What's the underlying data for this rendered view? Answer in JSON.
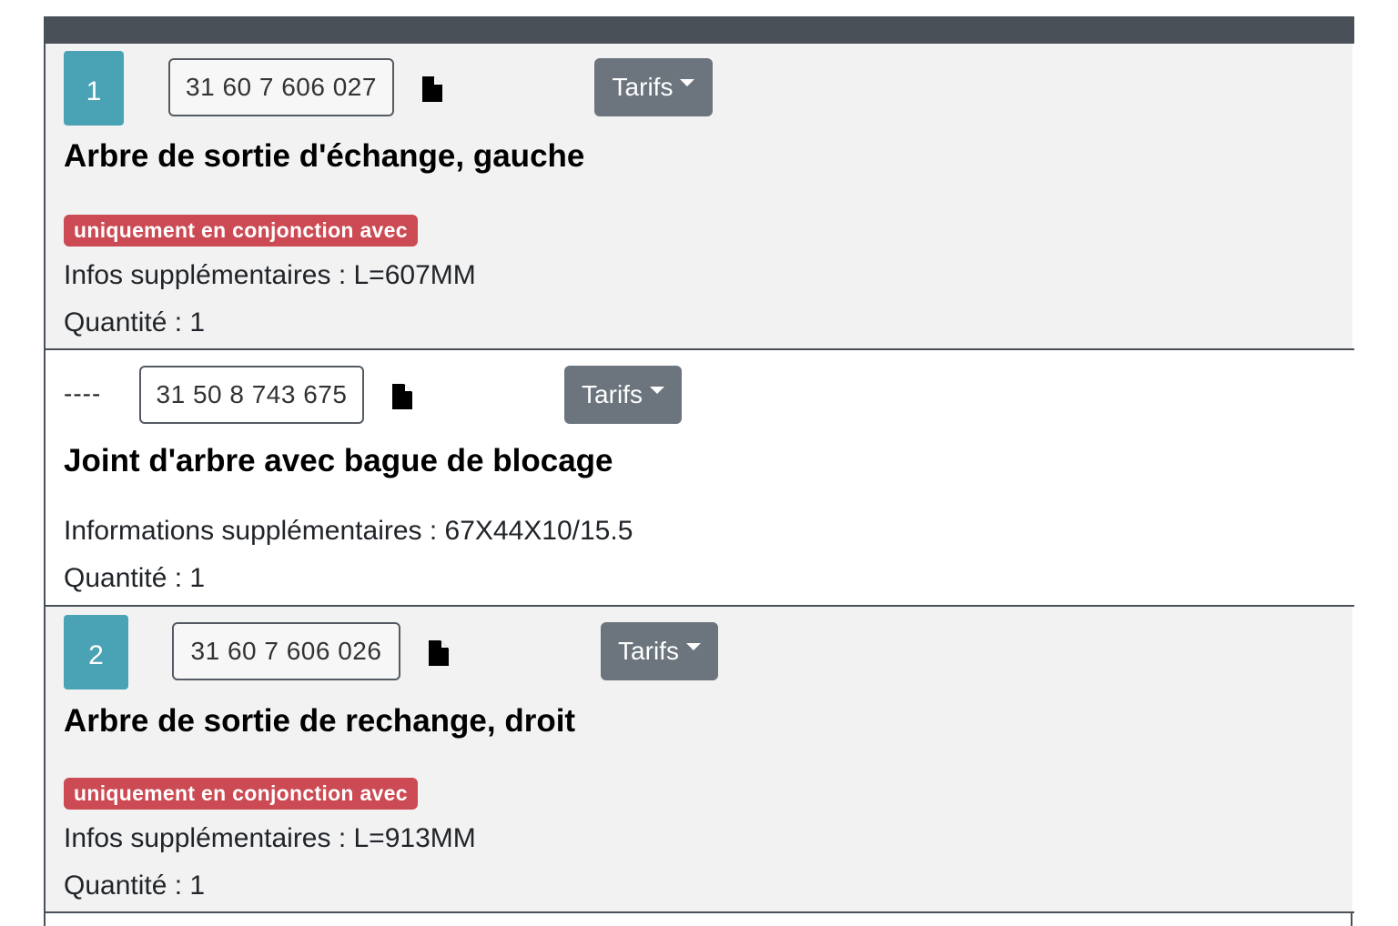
{
  "items": [
    {
      "position": "1",
      "reference": "31 60 7 606 027",
      "tarifs_label": "Tarifs",
      "title": "Arbre de sortie d'échange, gauche",
      "warning": "uniquement en conjonction avec",
      "info": "Infos supplémentaires : L=607MM",
      "quantity": "Quantité : 1"
    },
    {
      "position": "----",
      "reference": "31 50 8 743 675",
      "tarifs_label": "Tarifs",
      "title": "Joint d'arbre avec bague de blocage",
      "info": "Informations supplémentaires : 67X44X10/15.5",
      "quantity": "Quantité : 1"
    },
    {
      "position": "2",
      "reference": "31 60 7 606 026",
      "tarifs_label": "Tarifs",
      "title": "Arbre de sortie de rechange, droit",
      "warning": "uniquement en conjonction avec",
      "info": "Infos supplémentaires : L=913MM",
      "quantity": "Quantité : 1"
    }
  ],
  "icons": {
    "document": "document-icon",
    "dropdown": "caret-down-icon"
  },
  "colors": {
    "header": "#4a5058",
    "position_badge": "#4aa3b5",
    "warning_badge": "#cc4a53",
    "tarifs_button": "#6c757d",
    "row_shade": "#f2f2f2"
  }
}
